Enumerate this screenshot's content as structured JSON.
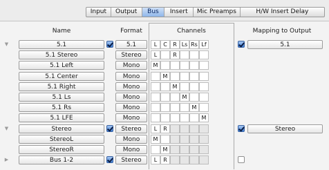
{
  "tabs": [
    {
      "label": "Input",
      "active": false
    },
    {
      "label": "Output",
      "active": false
    },
    {
      "label": "Bus",
      "active": true
    },
    {
      "label": "Insert",
      "active": false
    },
    {
      "label": "Mic Preamps",
      "active": false
    },
    {
      "label": "H/W Insert Delay",
      "active": false
    }
  ],
  "headers": {
    "name": "Name",
    "format": "Format",
    "channels": "Channels",
    "mapping": "Mapping to Output"
  },
  "channel_columns": [
    "L",
    "C",
    "R",
    "Ls",
    "Rs",
    "Lf"
  ],
  "rows": [
    {
      "disclosure": "▼",
      "name": "5.1",
      "name_checked": true,
      "format": "5.1",
      "assign": [
        "L",
        "C",
        "R",
        "Ls",
        "Rs",
        "Lf"
      ],
      "map_checked": true,
      "map_value": "5.1"
    },
    {
      "disclosure": "",
      "name": "5.1 Stereo",
      "format": "Stereo",
      "assign": [
        "L",
        "",
        "R",
        "",
        "",
        ""
      ]
    },
    {
      "disclosure": "",
      "name": "5.1 Left",
      "format": "Mono",
      "assign": [
        "M",
        "",
        "",
        "",
        "",
        ""
      ]
    },
    {
      "disclosure": "",
      "name": "5.1 Center",
      "format": "Mono",
      "assign": [
        "",
        "M",
        "",
        "",
        "",
        ""
      ]
    },
    {
      "disclosure": "",
      "name": "5.1 Right",
      "format": "Mono",
      "assign": [
        "",
        "",
        "M",
        "",
        "",
        ""
      ]
    },
    {
      "disclosure": "",
      "name": "5.1 Ls",
      "format": "Mono",
      "assign": [
        "",
        "",
        "",
        "M",
        "",
        ""
      ]
    },
    {
      "disclosure": "",
      "name": "5.1 Rs",
      "format": "Mono",
      "assign": [
        "",
        "",
        "",
        "",
        "M",
        ""
      ]
    },
    {
      "disclosure": "",
      "name": "5.1 LFE",
      "format": "Mono",
      "assign": [
        "",
        "",
        "",
        "",
        "",
        "M"
      ]
    },
    {
      "disclosure": "▼",
      "name": "Stereo",
      "name_checked": true,
      "format": "Stereo",
      "assign": [
        "L",
        "R"
      ],
      "map_checked": true,
      "map_value": "Stereo"
    },
    {
      "disclosure": "",
      "name": "StereoL",
      "format": "Mono",
      "assign": [
        "M",
        ""
      ]
    },
    {
      "disclosure": "",
      "name": "StereoR",
      "format": "Mono",
      "assign": [
        "",
        "M"
      ]
    },
    {
      "disclosure": "▶",
      "name": "Bus 1-2",
      "name_checked": true,
      "format": "Stereo",
      "assign": [
        "L",
        "R"
      ],
      "map_checked": false,
      "map_value": ""
    }
  ]
}
